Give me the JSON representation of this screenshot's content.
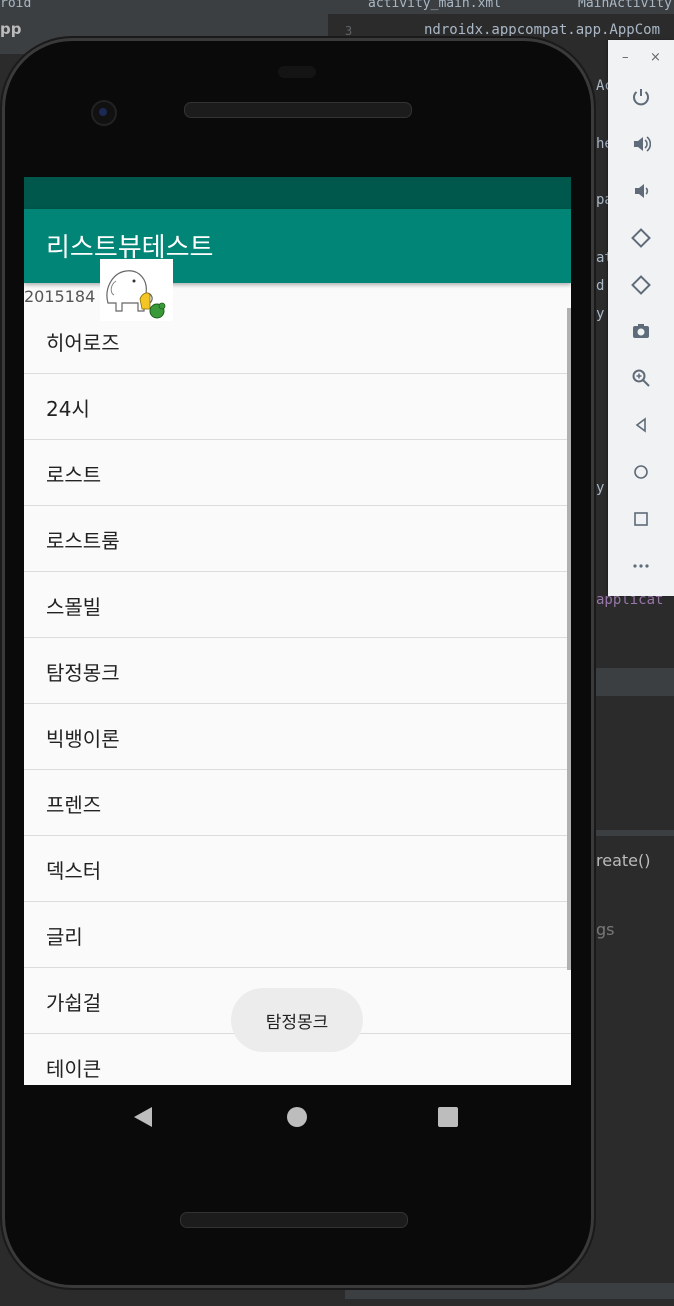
{
  "ide": {
    "top_left_label": "roid",
    "project_label": "pp",
    "tab_xml": "activity_main.xml",
    "tab_main": "MainActivity",
    "line_number": "3",
    "code_import": "ndroidx.appcompat.app.AppCom",
    "code_snip1": "Ac",
    "code_snip2": "he",
    "code_snip3": "pa",
    "code_snip4": "at",
    "code_snip5": "d",
    "code_snip6": "y",
    "code_snip7": "y",
    "code_applicat": "applicat",
    "method_label": "reate()",
    "logs_label": "gs"
  },
  "emulator_toolbar": {
    "minimize": "–",
    "close": "×",
    "buttons": [
      "power-icon",
      "volume-up-icon",
      "volume-down-icon",
      "rotate-left-icon",
      "rotate-right-icon",
      "camera-icon",
      "zoom-icon",
      "back-icon",
      "home-icon",
      "overview-icon",
      "more-icon"
    ]
  },
  "app": {
    "title": "리스트뷰테스트",
    "student_id": "2015184",
    "list_items": [
      "히어로즈",
      "24시",
      "로스트",
      "로스트룸",
      "스몰빌",
      "탐정몽크",
      "빅뱅이론",
      "프렌즈",
      "덱스터",
      "글리",
      "가쉽걸",
      "테이큰"
    ],
    "toast": "탐정몽크"
  },
  "colors": {
    "primary": "#008577",
    "primary_dark": "#00574b",
    "list_bg": "#fafafa"
  }
}
